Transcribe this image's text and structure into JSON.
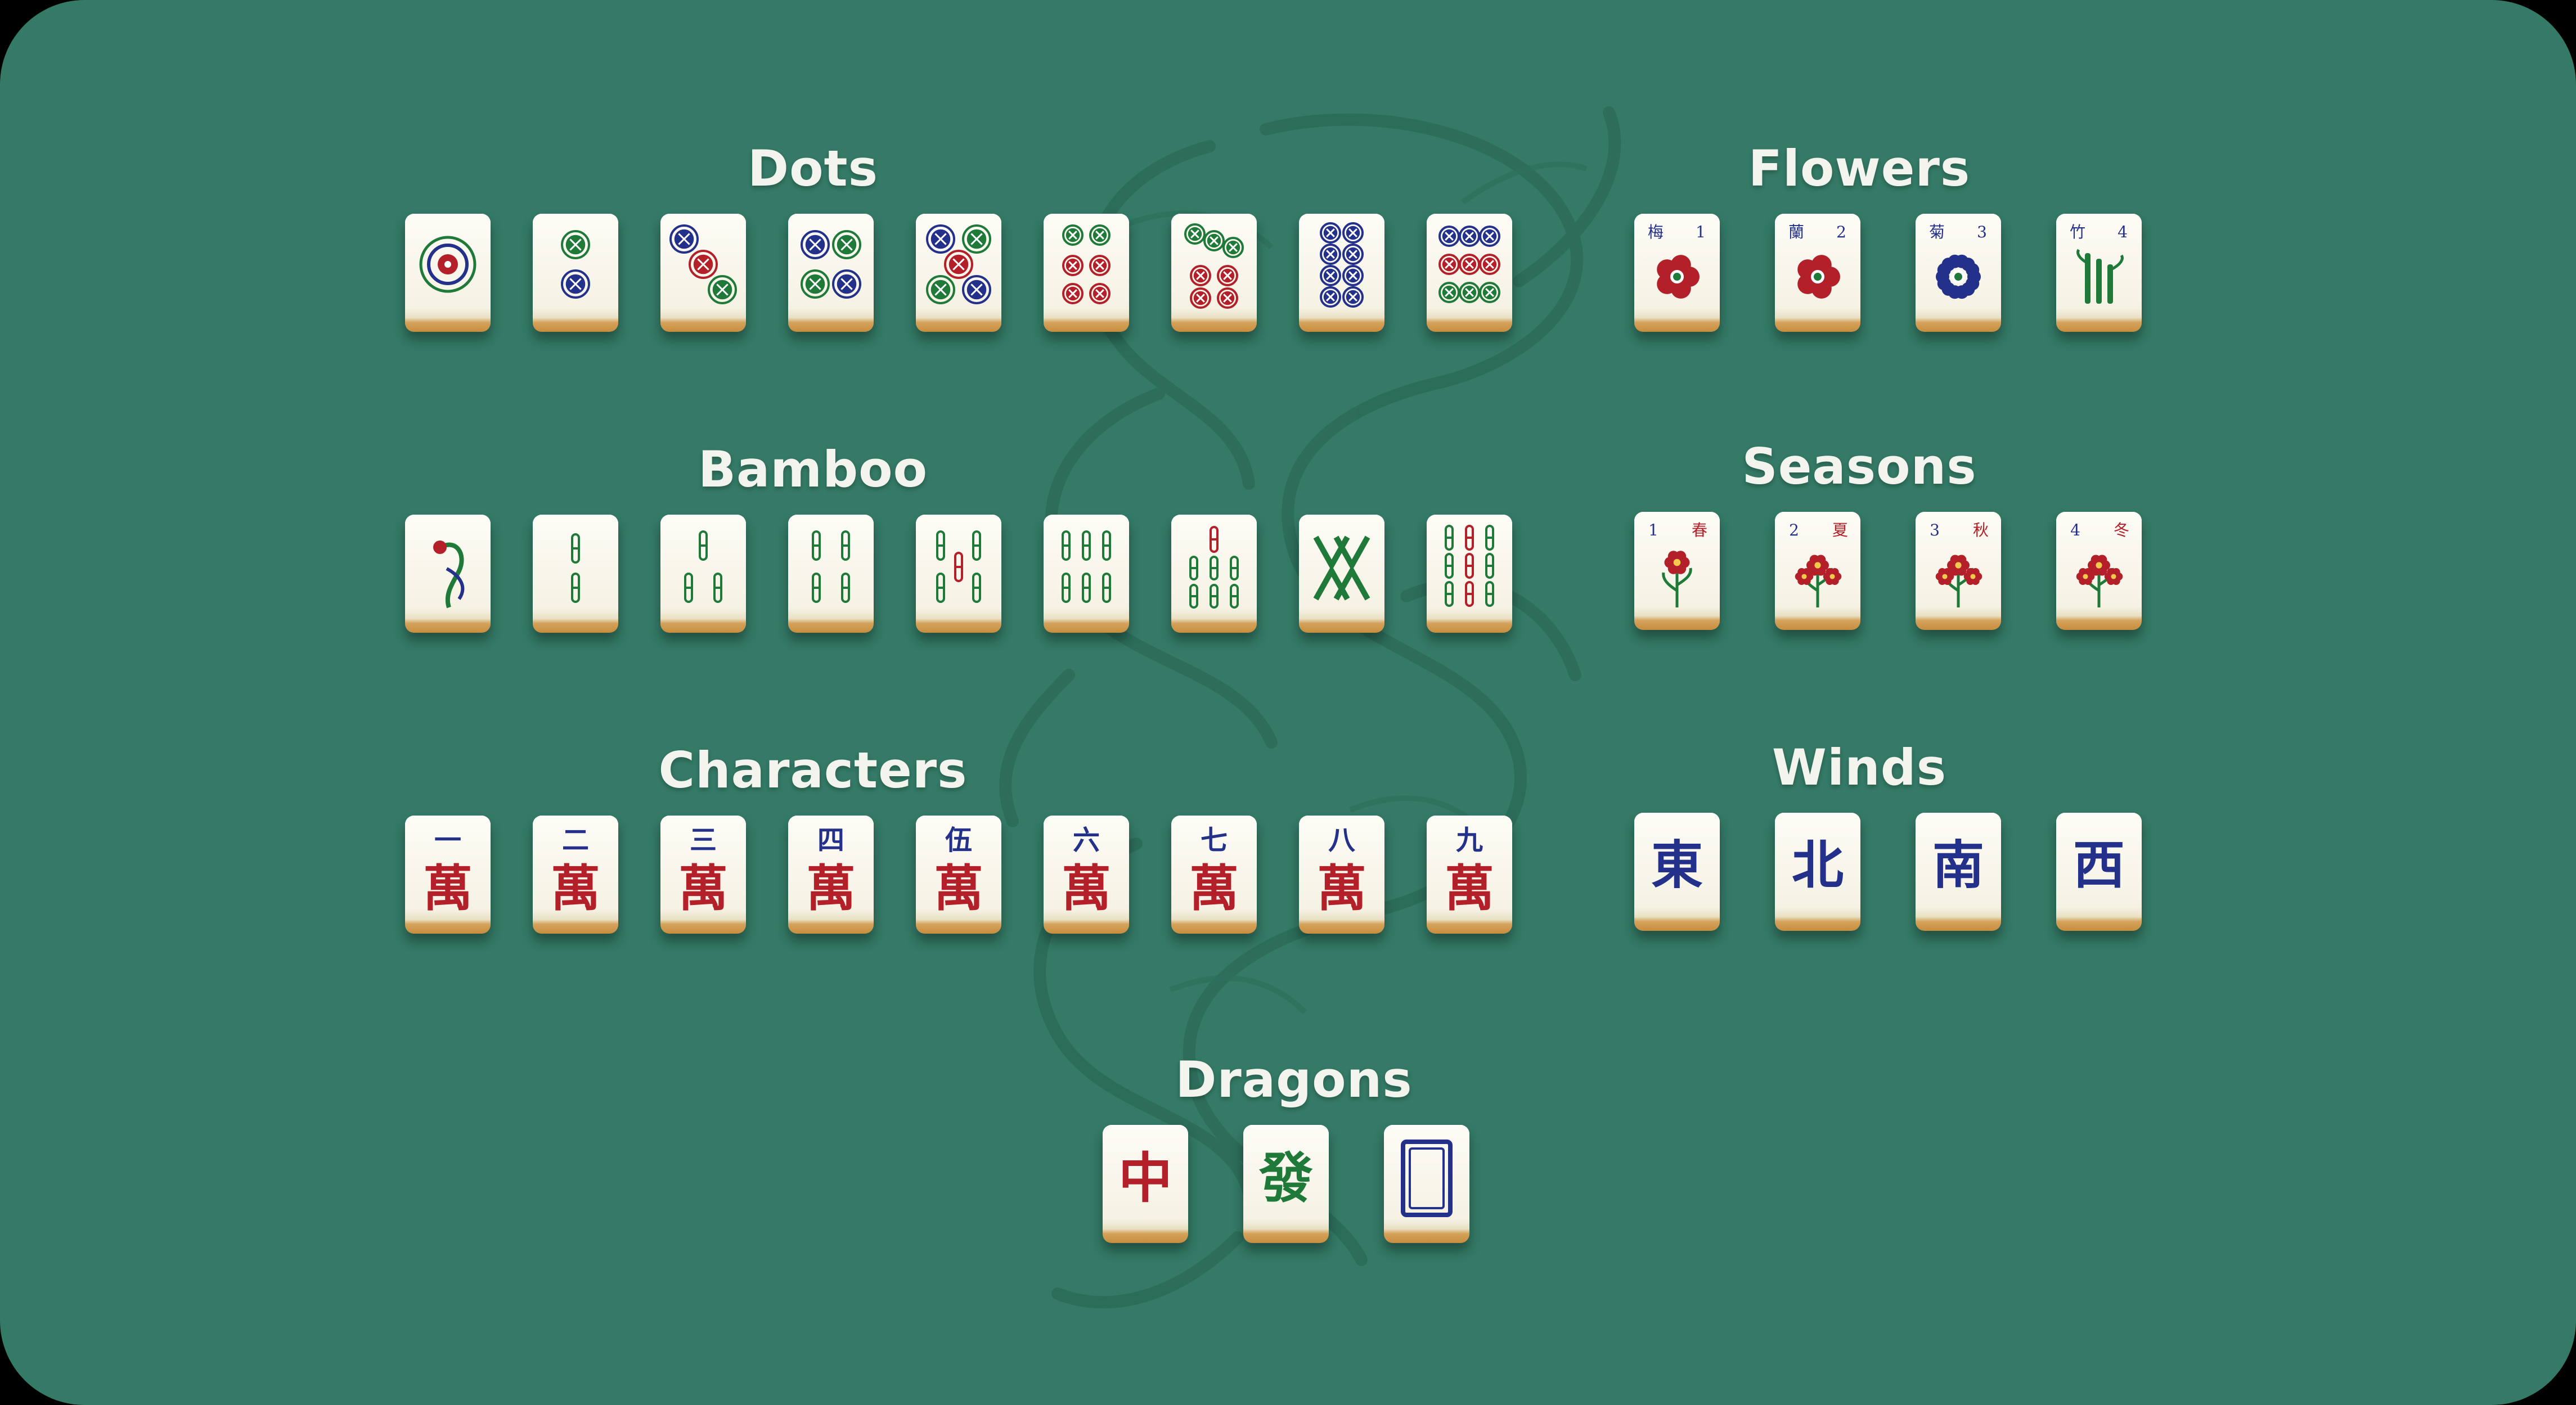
{
  "colors": {
    "felt": "#347a66",
    "dragon_watermark": "#2c6b58",
    "title": "#f4f4ee",
    "tile_face": "#fdfcf6",
    "tile_back": "#c88d3e",
    "red": "#b3202a",
    "green": "#1f7a3a",
    "blue": "#23318a"
  },
  "groups": {
    "dots": {
      "title": "Dots",
      "tiles": [
        {
          "kind": "dots",
          "value": 1
        },
        {
          "kind": "dots",
          "value": 2
        },
        {
          "kind": "dots",
          "value": 3
        },
        {
          "kind": "dots",
          "value": 4
        },
        {
          "kind": "dots",
          "value": 5
        },
        {
          "kind": "dots",
          "value": 6
        },
        {
          "kind": "dots",
          "value": 7
        },
        {
          "kind": "dots",
          "value": 8
        },
        {
          "kind": "dots",
          "value": 9
        }
      ]
    },
    "bamboo": {
      "title": "Bamboo",
      "tiles": [
        {
          "kind": "bamboo",
          "value": 1,
          "icon": "sparrow-icon"
        },
        {
          "kind": "bamboo",
          "value": 2
        },
        {
          "kind": "bamboo",
          "value": 3
        },
        {
          "kind": "bamboo",
          "value": 4
        },
        {
          "kind": "bamboo",
          "value": 5
        },
        {
          "kind": "bamboo",
          "value": 6
        },
        {
          "kind": "bamboo",
          "value": 7
        },
        {
          "kind": "bamboo",
          "value": 8
        },
        {
          "kind": "bamboo",
          "value": 9
        }
      ]
    },
    "characters": {
      "title": "Characters",
      "tiles": [
        {
          "kind": "character",
          "top": "一",
          "bottom": "萬"
        },
        {
          "kind": "character",
          "top": "二",
          "bottom": "萬"
        },
        {
          "kind": "character",
          "top": "三",
          "bottom": "萬"
        },
        {
          "kind": "character",
          "top": "四",
          "bottom": "萬"
        },
        {
          "kind": "character",
          "top": "伍",
          "bottom": "萬"
        },
        {
          "kind": "character",
          "top": "六",
          "bottom": "萬"
        },
        {
          "kind": "character",
          "top": "七",
          "bottom": "萬"
        },
        {
          "kind": "character",
          "top": "八",
          "bottom": "萬"
        },
        {
          "kind": "character",
          "top": "九",
          "bottom": "萬"
        }
      ]
    },
    "flowers": {
      "title": "Flowers",
      "tiles": [
        {
          "kind": "flower",
          "label": "梅",
          "number": "1",
          "icon": "plum-blossom-icon"
        },
        {
          "kind": "flower",
          "label": "蘭",
          "number": "2",
          "icon": "orchid-icon"
        },
        {
          "kind": "flower",
          "label": "菊",
          "number": "3",
          "icon": "chrysanthemum-icon"
        },
        {
          "kind": "flower",
          "label": "竹",
          "number": "4",
          "icon": "bamboo-plant-icon"
        }
      ]
    },
    "seasons": {
      "title": "Seasons",
      "tiles": [
        {
          "kind": "season",
          "label": "春",
          "number": "1",
          "icon": "tulip-icon"
        },
        {
          "kind": "season",
          "label": "夏",
          "number": "2",
          "icon": "summer-flower-icon"
        },
        {
          "kind": "season",
          "label": "秋",
          "number": "3",
          "icon": "autumn-flower-icon"
        },
        {
          "kind": "season",
          "label": "冬",
          "number": "4",
          "icon": "winter-flower-icon"
        }
      ]
    },
    "winds": {
      "title": "Winds",
      "tiles": [
        {
          "kind": "wind",
          "glyph": "東"
        },
        {
          "kind": "wind",
          "glyph": "北"
        },
        {
          "kind": "wind",
          "glyph": "南"
        },
        {
          "kind": "wind",
          "glyph": "西"
        }
      ]
    },
    "dragons": {
      "title": "Dragons",
      "tiles": [
        {
          "kind": "dragon",
          "glyph": "中",
          "color": "red"
        },
        {
          "kind": "dragon",
          "glyph": "發",
          "color": "green"
        },
        {
          "kind": "dragon",
          "glyph": "",
          "color": "blue",
          "icon": "white-dragon-frame-icon"
        }
      ]
    }
  }
}
